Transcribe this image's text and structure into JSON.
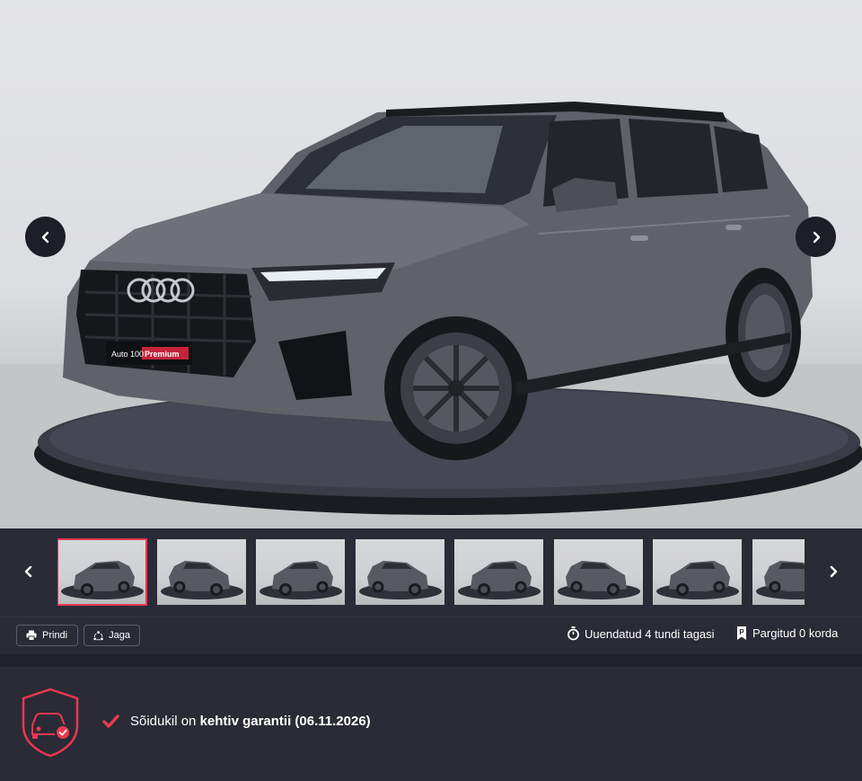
{
  "gallery": {
    "prev_icon": "chevron-left-icon",
    "next_icon": "chevron-right-icon",
    "plate_text": "Auto 100",
    "plate_highlight": "Premium",
    "thumbnail_count": 8,
    "active_thumbnail": 1
  },
  "toolbar": {
    "print_label": "Prindi",
    "share_label": "Jaga",
    "updated_text": "Uuendatud 4 tundi tagasi",
    "parked_text": "Pargitud 0 korda"
  },
  "warranty": {
    "prefix": "Sõidukil on ",
    "bold": "kehtiv garantii (06.11.2026)"
  },
  "colors": {
    "accent": "#e8394f",
    "background": "#2a2b36"
  }
}
